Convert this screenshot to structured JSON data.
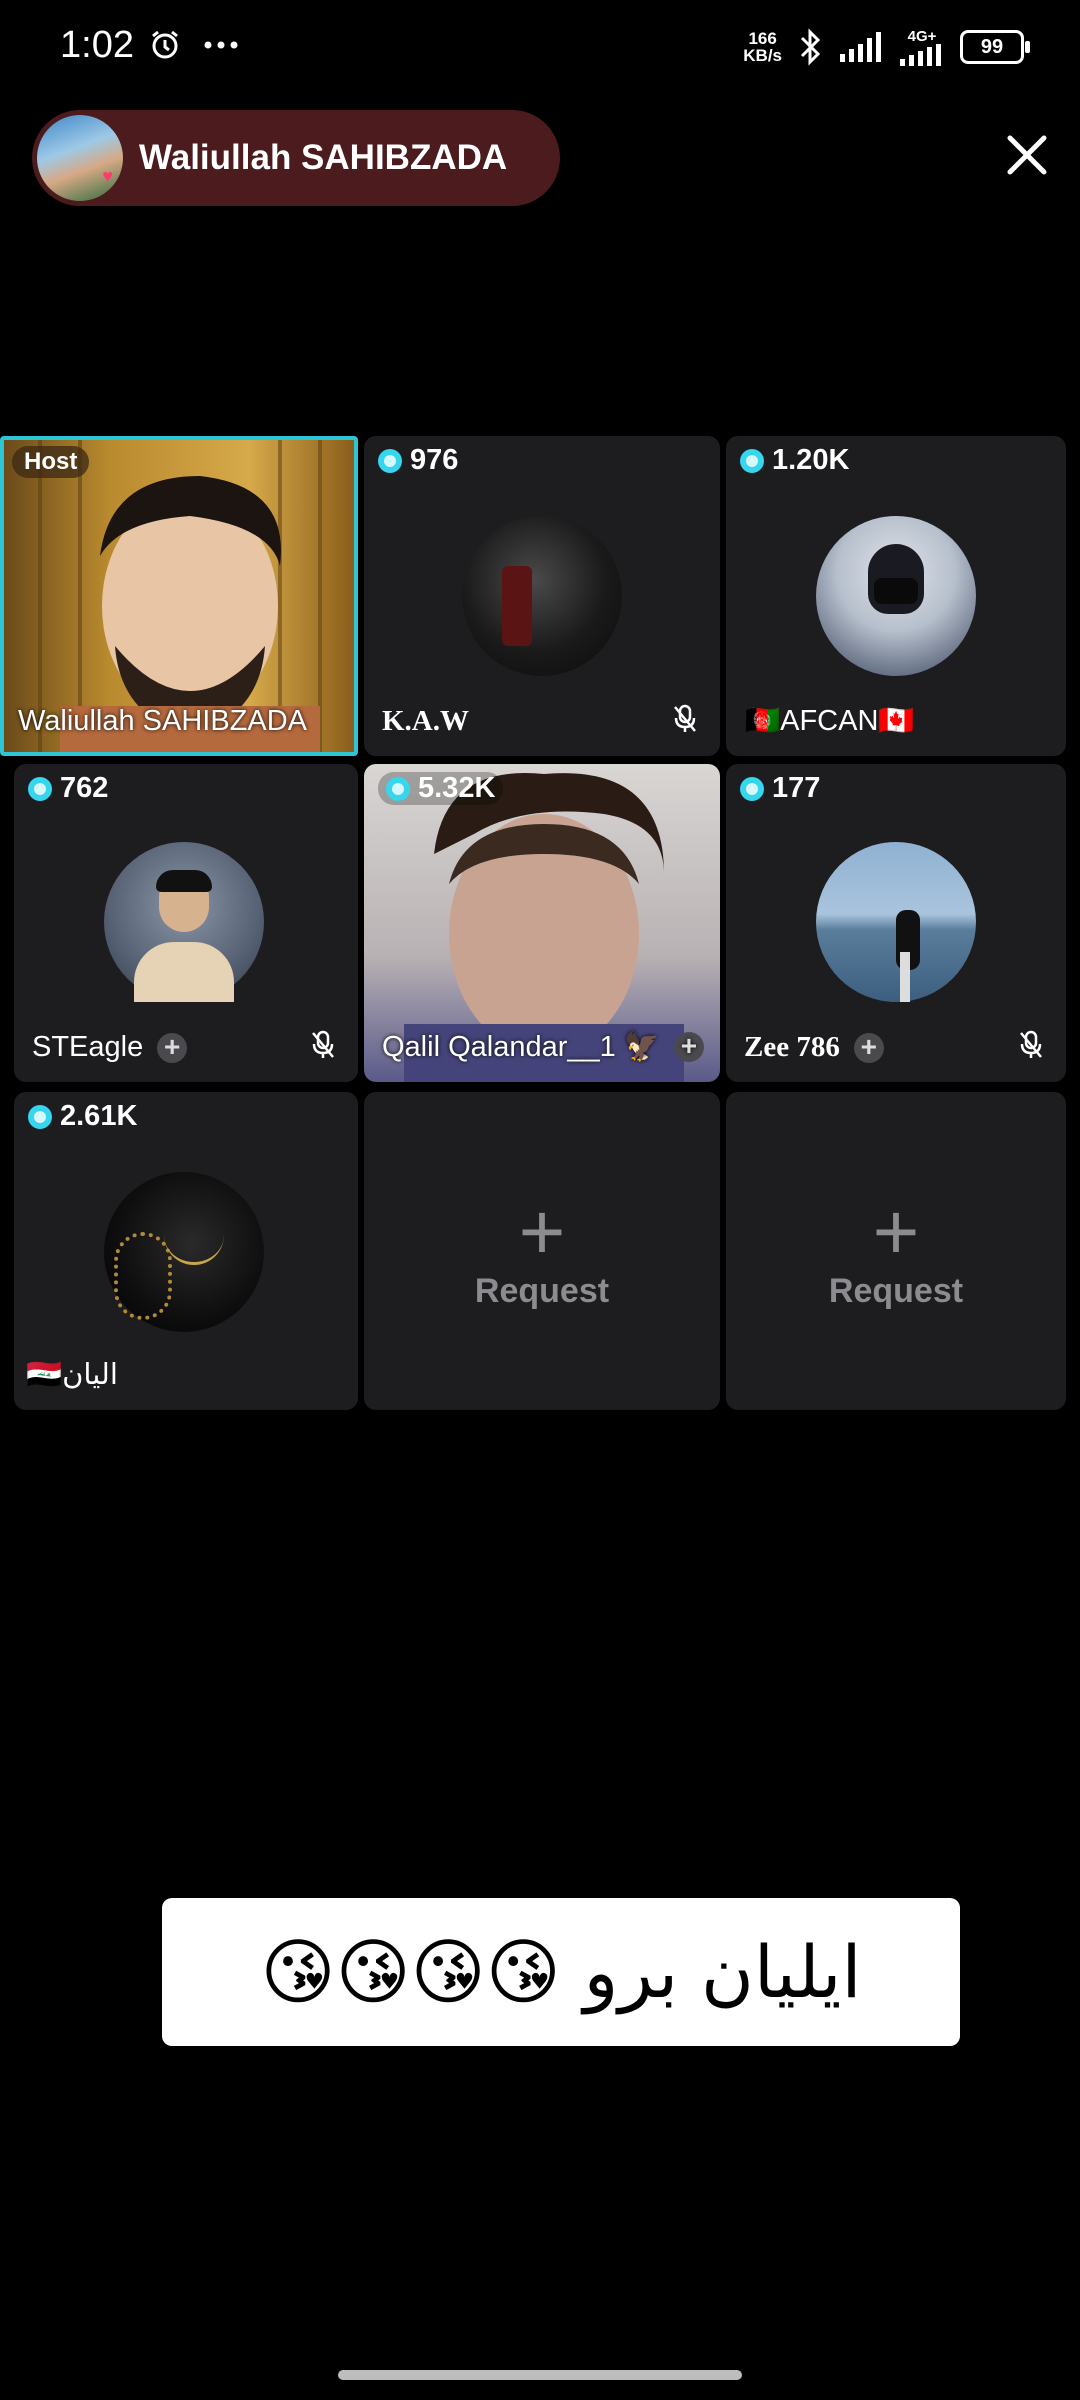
{
  "status_bar": {
    "time": "1:02",
    "net_speed_value": "166",
    "net_speed_unit": "KB/s",
    "network": "4G+",
    "battery": "99"
  },
  "header": {
    "host_name": "Waliullah SAHIBZADA"
  },
  "tiles": [
    {
      "badge": "Host",
      "name": "Waliullah SAHIBZADA"
    },
    {
      "count": "976",
      "name": "K.A.W"
    },
    {
      "count": "1.20K",
      "name": "🇦🇫AFCAN🇨🇦"
    },
    {
      "count": "762",
      "name": "STEagle"
    },
    {
      "count": "5.32K",
      "name": "Qalil Qalandar__1 🦅"
    },
    {
      "count": "177",
      "name": "Zee 786"
    },
    {
      "count": "2.61K",
      "name": "🇮🇶الیان"
    },
    {
      "name": "Request"
    },
    {
      "name": "Request"
    }
  ],
  "message": {
    "text": "ایلیان برو 😘😘😘😘"
  },
  "colors": {
    "host_border": "#2ec5d6",
    "pill": "#4b1b1e",
    "gem": "#35d6ee"
  }
}
